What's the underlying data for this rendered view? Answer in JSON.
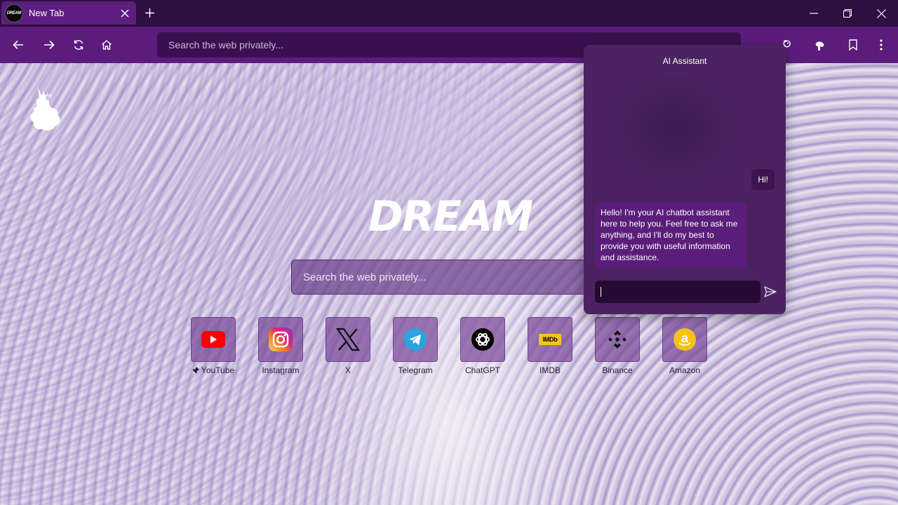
{
  "tab": {
    "title": "New Tab",
    "favicon_text": "DREAM",
    "close_icon": "close-icon"
  },
  "window": {
    "controls": [
      "minimize-icon",
      "restore-icon",
      "close-icon"
    ]
  },
  "toolbar": {
    "omnibox_placeholder": "Search the web privately...",
    "nav_icons": [
      "back-icon",
      "forward-icon",
      "reload-icon",
      "home-icon"
    ],
    "right_icons": [
      "ai-assistant-icon",
      "extension-icon",
      "bookmark-icon",
      "menu-icon"
    ]
  },
  "page": {
    "brand": "DREAM",
    "search_placeholder": "Search the web privately...",
    "shortcuts": [
      {
        "label": "YouTube",
        "icon": "youtube-icon",
        "pinned": true
      },
      {
        "label": "Instagram",
        "icon": "instagram-icon"
      },
      {
        "label": "X",
        "icon": "x-icon"
      },
      {
        "label": "Telegram",
        "icon": "telegram-icon"
      },
      {
        "label": "ChatGPT",
        "icon": "chatgpt-icon"
      },
      {
        "label": "IMDB",
        "icon": "imdb-icon",
        "badge_text": "IMDb"
      },
      {
        "label": "Binance",
        "icon": "binance-icon"
      },
      {
        "label": "Amazon",
        "icon": "amazon-icon",
        "badge_text": "a"
      }
    ]
  },
  "ai_assistant": {
    "title": "AI Assistant",
    "messages": [
      {
        "role": "user",
        "text": "Hi!"
      },
      {
        "role": "assistant",
        "text": "Hello! I'm your AI chatbot assistant here to help you. Feel free to ask me anything, and I'll do my best to provide you with useful information and assistance."
      }
    ],
    "input_value": "",
    "send_icon": "send-icon"
  },
  "colors": {
    "tabstrip": "#2d0f40",
    "toolbar": "#5c1c7c",
    "active_tab": "#5e1e80",
    "panel": "#4b2462",
    "bot_bubble": "#5a1e7a"
  }
}
